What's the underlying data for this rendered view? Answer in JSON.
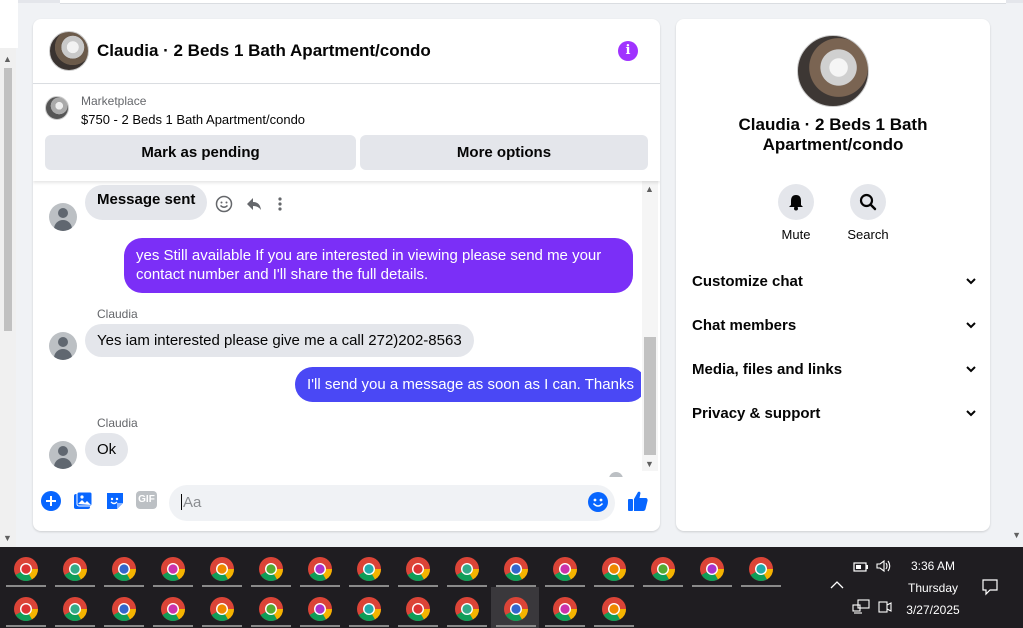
{
  "chat": {
    "title": "Claudia · 2 Beds 1 Bath Apartment/condo",
    "info_icon": "i",
    "marketplace_label": "Marketplace",
    "listing": "$750 - 2 Beds 1 Bath Apartment/condo",
    "mark_pending": "Mark as pending",
    "more_options": "More options"
  },
  "messages": [
    {
      "from": "them",
      "text": "Message sent"
    },
    {
      "from": "me",
      "text": "yes Still available If you are interested in viewing please send me your contact number and I'll share the full details."
    },
    {
      "from": "them",
      "sender": "Claudia",
      "text": "Yes iam interested please give me a call 272)202-8563"
    },
    {
      "from": "me",
      "text": "I'll send you a message as soon as I can. Thanks"
    },
    {
      "from": "them",
      "sender": "Claudia",
      "text": "Ok"
    }
  ],
  "composer": {
    "placeholder": "Aa",
    "gif_label": "GIF"
  },
  "details": {
    "title": "Claudia · 2 Beds 1 Bath Apartment/condo",
    "mute": "Mute",
    "search": "Search",
    "rows": [
      "Customize chat",
      "Chat members",
      "Media, files and links",
      "Privacy & support"
    ]
  },
  "tray": {
    "time": "3:36 AM",
    "day": "Thursday",
    "date": "3/27/2025"
  },
  "colors": {
    "accent_purple": "#a033ff",
    "bubble_out_1": "#7b2ff7",
    "bubble_out_2": "#4a48f5",
    "messenger_blue": "#0866ff"
  },
  "icons": [
    "info-icon",
    "smiley-icon",
    "reply-icon",
    "more-icon",
    "plus-icon",
    "photo-icon",
    "sticker-icon",
    "gif-icon",
    "emoji-icon",
    "like-icon",
    "bell-icon",
    "search-icon",
    "chevron-down-icon",
    "chrome-icon",
    "battery-icon",
    "volume-icon",
    "network-icon",
    "notification-icon"
  ]
}
